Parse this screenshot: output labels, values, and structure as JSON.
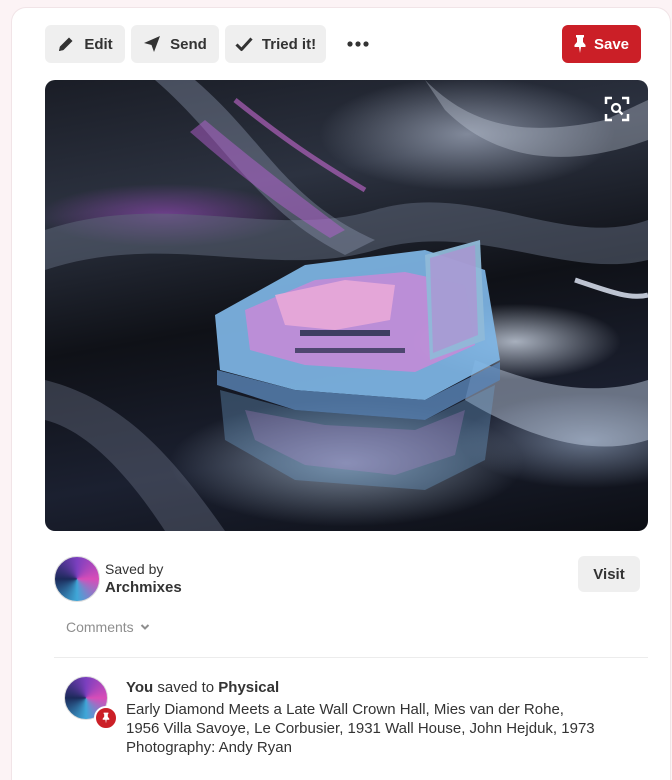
{
  "toolbar": {
    "edit_label": "Edit",
    "send_label": "Send",
    "tried_label": "Tried it!",
    "save_label": "Save"
  },
  "pin": {
    "image_icon": "visual-search-icon"
  },
  "saved_by": {
    "label": "Saved by",
    "name": "Archmixes",
    "visit_label": "Visit"
  },
  "comments": {
    "label": "Comments"
  },
  "activity": {
    "actor": "You",
    "verb": "saved to",
    "board": "Physical",
    "description": "Early Diamond Meets a Late Wall Crown Hall, Mies van der Rohe, 1956 Villa Savoye, Le Corbusier, 1931 Wall House, John Hejduk, 1973 Photography: Andy Ryan"
  },
  "colors": {
    "accent_red": "#cb1f27",
    "button_gray": "#efefef",
    "text": "#333333",
    "muted_text": "#8e8e8e"
  }
}
